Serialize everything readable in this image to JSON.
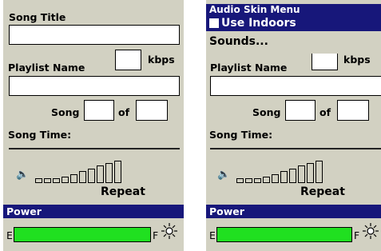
{
  "left": {
    "song_title_label": "Song Title",
    "playlist_label": "Playlist Name",
    "kbps_label": "kbps",
    "song_label": "Song",
    "of_label": "of",
    "song_time_label": "Song Time:",
    "repeat_label": "Repeat",
    "power_title": "Power",
    "gauge_empty_label": "E",
    "gauge_full_label": "F",
    "power_level": 1.0,
    "volume_level": 0.3
  },
  "right": {
    "menu": {
      "title": "Audio Skin Menu",
      "selected_item": "Use Indoors",
      "item2": "Sounds..."
    },
    "kbps_label": "kbps",
    "playlist_label": "Playlist Name",
    "song_label": "Song",
    "of_label": "of",
    "song_time_label": "Song Time:",
    "repeat_label": "Repeat",
    "power_title": "Power",
    "gauge_empty_label": "E",
    "gauge_full_label": "F",
    "power_level": 1.0,
    "volume_level": 0.3
  },
  "icons": {
    "speaker": "speaker-icon",
    "backlight": "light-bulb-icon"
  },
  "colors": {
    "panel_bg": "#d2d1c2",
    "titlebar": "#17177a",
    "gauge_fill": "#20e020"
  }
}
